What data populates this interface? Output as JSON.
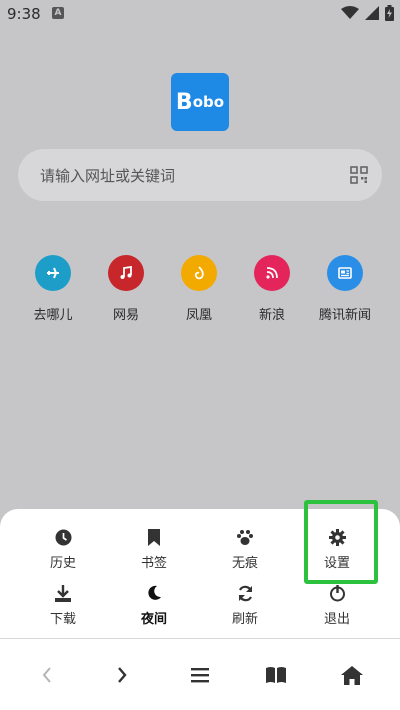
{
  "status_bar": {
    "time": "9:38",
    "notification_icon": "a-icon",
    "icons": [
      "wifi-icon",
      "signal-icon",
      "battery-charging-icon"
    ]
  },
  "logo": {
    "big": "B",
    "small": "obo",
    "color": "#1e8ae6"
  },
  "search": {
    "placeholder": "请输入网址或关键词",
    "icon": "scan-icon"
  },
  "quick_links": [
    {
      "label": "去哪儿",
      "color": "#1c9ec9",
      "icon": "plane-icon"
    },
    {
      "label": "网易",
      "color": "#c7262a",
      "icon": "music-icon"
    },
    {
      "label": "凤凰",
      "color": "#f2a900",
      "icon": "phoenix-icon"
    },
    {
      "label": "新浪",
      "color": "#e4255b",
      "icon": "rss-icon"
    },
    {
      "label": "腾讯新闻",
      "color": "#2b8ee6",
      "icon": "news-icon"
    }
  ],
  "menu": {
    "row1": [
      {
        "label": "历史",
        "icon": "clock-icon"
      },
      {
        "label": "书签",
        "icon": "bookmark-icon"
      },
      {
        "label": "无痕",
        "icon": "paw-icon"
      },
      {
        "label": "设置",
        "icon": "gear-icon"
      }
    ],
    "row2": [
      {
        "label": "下载",
        "icon": "download-icon"
      },
      {
        "label": "夜间",
        "icon": "moon-icon"
      },
      {
        "label": "刷新",
        "icon": "refresh-icon"
      },
      {
        "label": "退出",
        "icon": "power-icon"
      }
    ],
    "highlight_color": "#2dc23e"
  },
  "navbar": {
    "buttons": [
      "back-icon",
      "forward-icon",
      "menu-icon",
      "book-icon",
      "home-icon"
    ]
  }
}
